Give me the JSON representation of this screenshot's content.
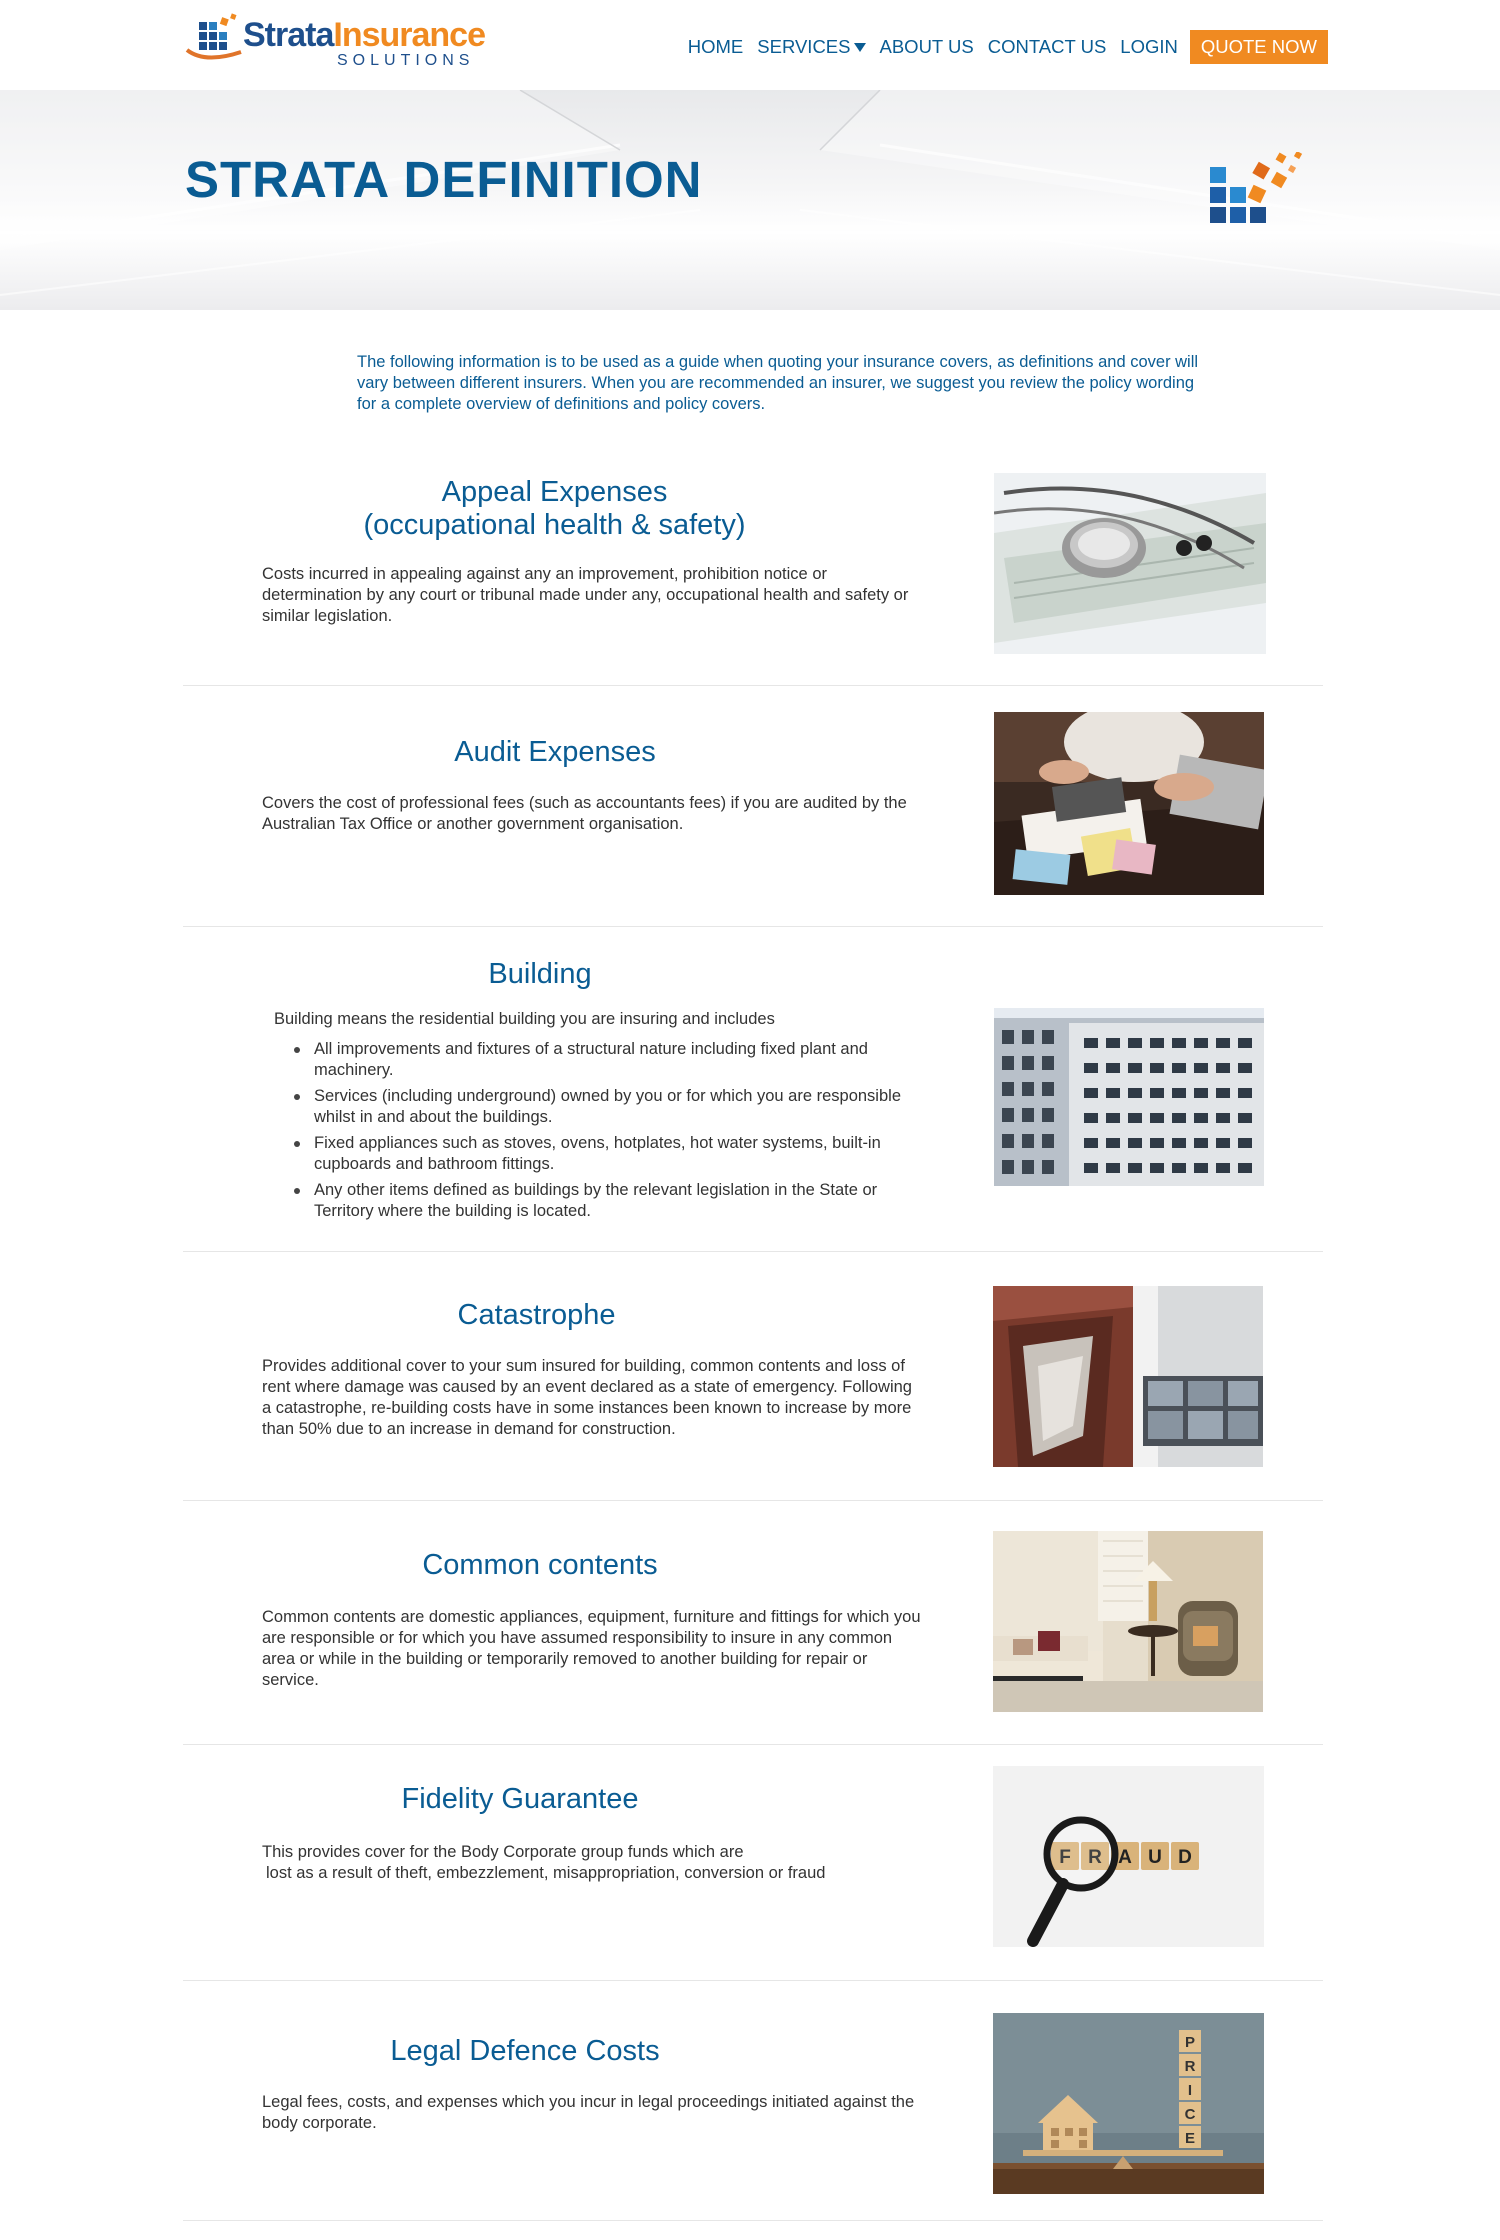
{
  "header": {
    "logo": {
      "word1": "Strata",
      "word2": "Insurance",
      "sub": "SOLUTIONS"
    },
    "nav": {
      "home": "HOME",
      "services": "SERVICES",
      "about": "ABOUT US",
      "contact": "CONTACT US",
      "login": "LOGIN",
      "quote": "QUOTE NOW"
    }
  },
  "banner": {
    "title": "STRATA DEFINITION"
  },
  "intro": "The following information is to be used as a guide when quoting your insurance covers, as definitions and cover will vary between different insurers. When you are recommended an insurer, we suggest you review the policy wording for a complete overview of definitions and policy covers.",
  "sections": [
    {
      "title_line1": "Appeal Expenses",
      "title_line2": "(occupational health & safety)",
      "body": "Costs incurred in appealing against any an improvement, prohibition notice or determination by any court or tribunal made under any, occupational health and safety or similar legislation."
    },
    {
      "title": "Audit Expenses",
      "body": "Covers the cost of professional fees (such as accountants fees) if you are audited by the Australian Tax Office or another government organisation."
    },
    {
      "title": "Building",
      "intro": "Building means the residential building you are insuring and includes",
      "items": [
        "All improvements and fixtures of a structural nature including fixed plant and machinery.",
        "Services (including underground) owned by you or for which you are responsible whilst in and about the buildings.",
        "Fixed appliances such as stoves, ovens, hotplates, hot water systems, built-in cupboards and bathroom fittings.",
        "Any other items defined as buildings by the relevant legislation in the State or Territory where the building is located."
      ]
    },
    {
      "title": "Catastrophe",
      "body": "Provides additional cover to your sum insured for building, common contents and loss of rent where damage was caused by an event declared as a state of emergency. Following a catastrophe, re-building costs have in some instances been known to increase by more than 50% due to an increase in demand for construction."
    },
    {
      "title": "Common contents",
      "body": "Common contents are domestic appliances, equipment, furniture and fittings for which you are responsible or for which you have assumed responsibility to insure in any common area or while in the building or temporarily removed to another building for repair or service."
    },
    {
      "title": "Fidelity Guarantee",
      "body_line1": "This provides cover for the Body Corporate group funds which are",
      "body_line2": "lost as a result of theft, embezzlement, misappropriation, conversion or fraud"
    },
    {
      "title": "Legal Defence Costs",
      "body": "Legal fees, costs, and expenses which you incur in legal proceedings initiated against the body corporate."
    }
  ],
  "images": {
    "fraud_letters": [
      "F",
      "R",
      "A",
      "U",
      "D"
    ],
    "price_letters": [
      "P",
      "R",
      "I",
      "C",
      "E"
    ]
  },
  "colors": {
    "brand_blue": "#0a5c93",
    "accent_orange": "#f08a21",
    "logo_navy": "#1e4f8c"
  }
}
